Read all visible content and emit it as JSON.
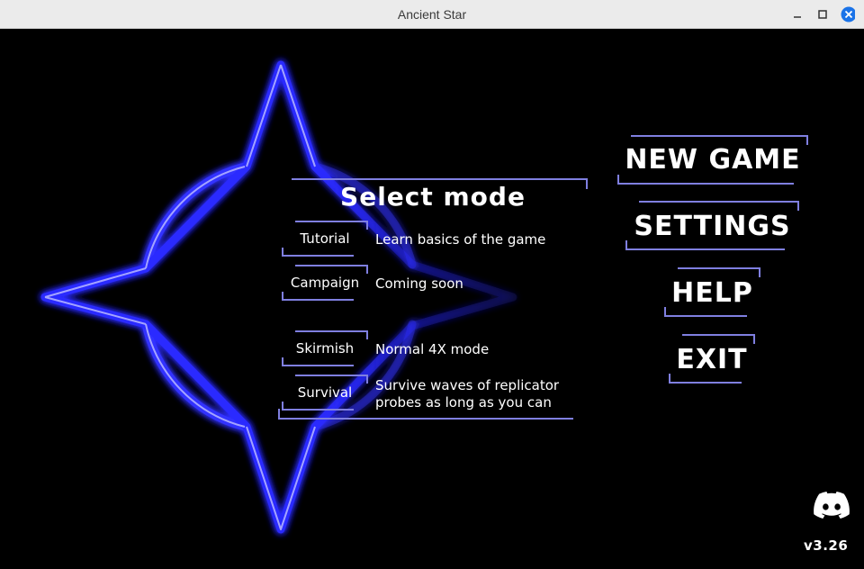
{
  "window": {
    "title": "Ancient Star",
    "minimize_icon": "minimize-icon",
    "maximize_icon": "maximize-icon",
    "close_icon": "close-icon",
    "close_color": "#1a73e8"
  },
  "theme": {
    "accent": "#7f7fe0",
    "glow": "#2b2bff",
    "background": "#000000"
  },
  "select_mode": {
    "title": "Select mode",
    "modes": [
      {
        "label": "Tutorial",
        "desc": "Learn basics of the game"
      },
      {
        "label": "Campaign",
        "desc": "Coming soon"
      },
      {
        "label": "Skirmish",
        "desc": "Normal 4X mode"
      },
      {
        "label": "Survival",
        "desc_line1": "Survive waves of replicator",
        "desc_line2": "probes as long as you can"
      }
    ]
  },
  "main_menu": {
    "new_game": "NEW GAME",
    "settings": "SETTINGS",
    "help": "HELP",
    "exit": "EXIT"
  },
  "footer": {
    "discord_icon": "discord-icon",
    "version": "v3.26"
  }
}
